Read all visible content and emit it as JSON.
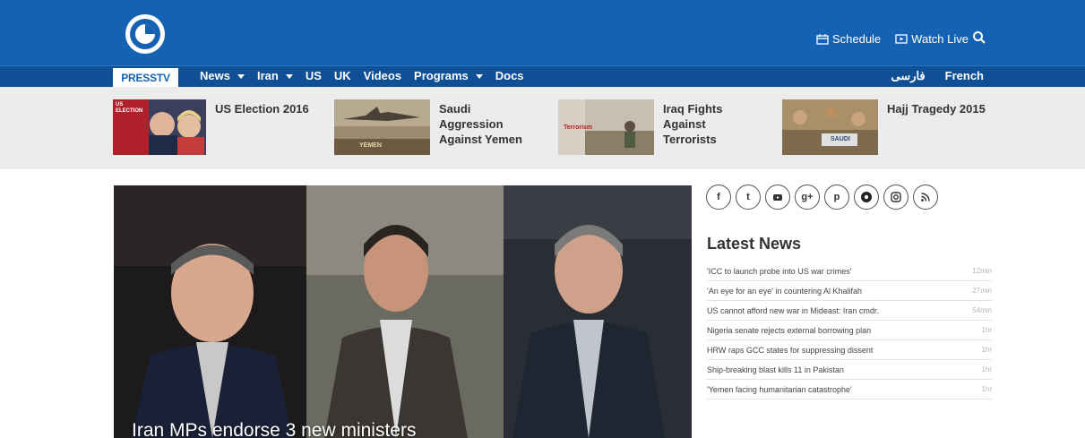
{
  "brand": {
    "name": "PRESSTV"
  },
  "header": {
    "links": [
      {
        "label": "Schedule",
        "icon": "calendar-icon"
      },
      {
        "label": "Watch Live",
        "icon": "tv-icon"
      }
    ],
    "search_icon": "search-icon"
  },
  "nav": {
    "items": [
      {
        "label": "News",
        "dropdown": true
      },
      {
        "label": "Iran",
        "dropdown": true
      },
      {
        "label": "US",
        "dropdown": false
      },
      {
        "label": "UK",
        "dropdown": false
      },
      {
        "label": "Videos",
        "dropdown": false
      },
      {
        "label": "Programs",
        "dropdown": true
      },
      {
        "label": "Docs",
        "dropdown": false
      }
    ],
    "languages": [
      "فارسی",
      "French"
    ]
  },
  "topics": [
    {
      "title": "US Election 2016",
      "thumb_text": "US ELECTION"
    },
    {
      "title": "Saudi Aggression Against Yemen",
      "thumb_text": "YEMEN"
    },
    {
      "title": "Iraq Fights Against Terrorists",
      "thumb_text": "Terrorism"
    },
    {
      "title": "Hajj Tragedy 2015",
      "thumb_text": "SAUDI"
    }
  ],
  "hero": {
    "caption": "Iran MPs endorse 3 new ministers"
  },
  "social": [
    "f",
    "t",
    "yt",
    "g+",
    "p",
    "o",
    "ig",
    "rss"
  ],
  "latest": {
    "title": "Latest News",
    "items": [
      {
        "text": "'ICC to launch probe into US war crimes'",
        "time": "12min"
      },
      {
        "text": "'An eye for an eye' in countering Al Khalifah",
        "time": "27min"
      },
      {
        "text": "US cannot afford new war in Mideast: Iran cmdr.",
        "time": "54min"
      },
      {
        "text": "Nigeria senate rejects external borrowing plan",
        "time": "1hr"
      },
      {
        "text": "HRW raps GCC states for suppressing dissent",
        "time": "1hr"
      },
      {
        "text": "Ship-breaking blast kills 11 in Pakistan",
        "time": "1hr"
      },
      {
        "text": "'Yemen facing humanitarian catastrophe'",
        "time": "1hr"
      }
    ]
  }
}
